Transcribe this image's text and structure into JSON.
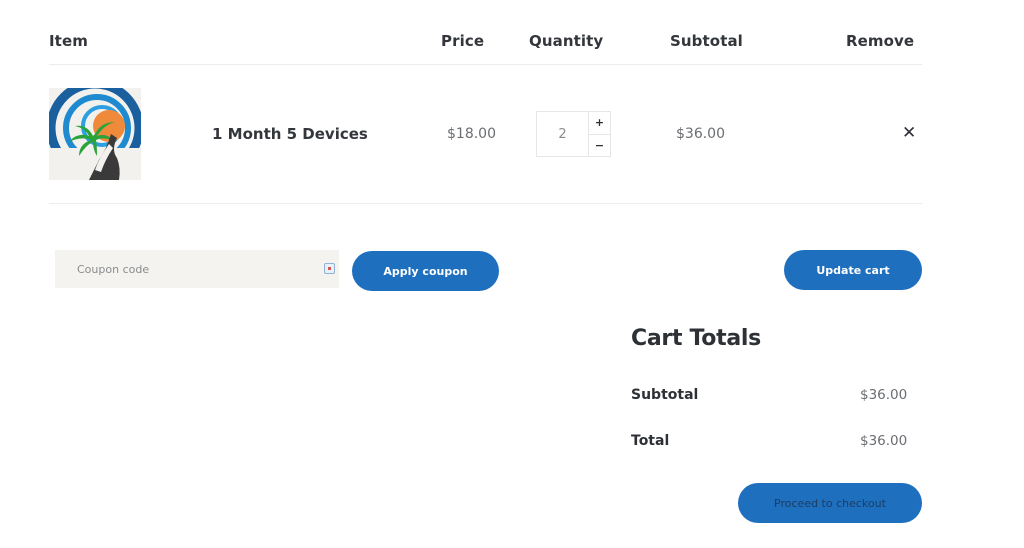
{
  "table": {
    "headers": {
      "item": "Item",
      "price": "Price",
      "quantity": "Quantity",
      "subtotal": "Subtotal",
      "remove": "Remove"
    },
    "rows": [
      {
        "image_icon": "product-logo-palm-tree-sun",
        "name": "1 Month 5 Devices",
        "price": "$18.00",
        "quantity": "2",
        "subtotal": "$36.00",
        "remove_symbol": "✕"
      }
    ],
    "qty_plus": "+",
    "qty_minus": "−"
  },
  "coupon": {
    "placeholder": "Coupon code",
    "value": "",
    "apply_label": "Apply coupon"
  },
  "update_label": "Update cart",
  "totals": {
    "title": "Cart Totals",
    "subtotal_label": "Subtotal",
    "subtotal_value": "$36.00",
    "total_label": "Total",
    "total_value": "$36.00",
    "checkout_label": "Proceed to checkout"
  },
  "colors": {
    "accent": "#1f6fbf",
    "text_dark": "#2d3035",
    "text_muted": "#6a6d72",
    "coupon_bg": "#f4f3ef"
  }
}
